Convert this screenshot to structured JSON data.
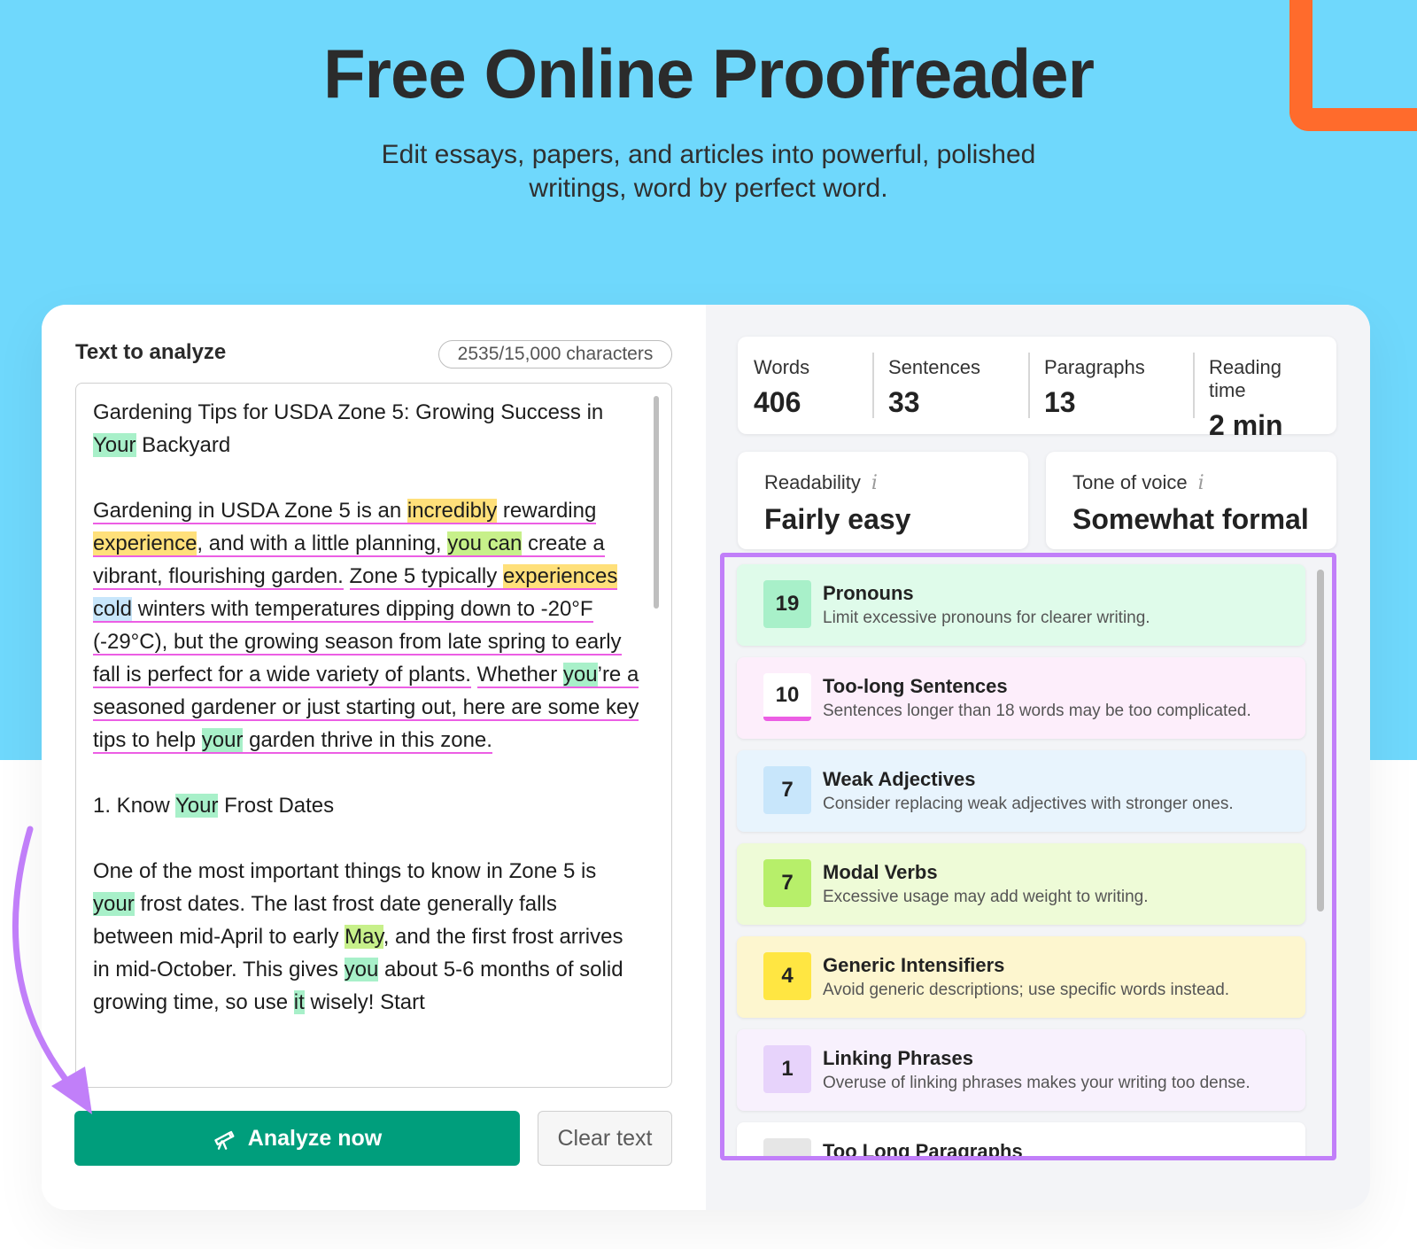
{
  "hero": {
    "title": "Free Online Proofreader",
    "subtitle_line1": "Edit essays, papers, and articles into powerful, polished",
    "subtitle_line2": "writings, word by perfect word."
  },
  "editor": {
    "label": "Text to analyze",
    "char_count": "2535/15,000 characters",
    "analyze_button": "Analyze now",
    "clear_button": "Clear text"
  },
  "text": {
    "title_a": "Gardening Tips for USDA Zone 5: Growing Success in ",
    "title_your": "Your",
    "title_b": " Backyard",
    "p1_a": "Gardening in USDA Zone 5 is an ",
    "p1_incredibly": "incredibly",
    "p1_b": " rewarding ",
    "p1_experience": "experience",
    "p1_c": ", and with a little planning, ",
    "p1_youcan": "you can",
    "p1_d": " create a vibrant, flourishing garden.",
    "p1_e": "Zone 5 typically ",
    "p1_experiences": "experiences",
    "p1_f": " ",
    "p1_cold": "cold",
    "p1_g": " winters with temperatures dipping down to -20°F (-29°C), but the growing season from late spring to early fall is perfect for a wide variety of plants.",
    "p1_h": "Whether ",
    "p1_you": "you",
    "p1_i": "’re a seasoned gardener or just starting out, here are some key tips to help ",
    "p1_your": "your",
    "p1_j": " garden thrive in this zone.",
    "h1_a": "1. Know ",
    "h1_your": "Your",
    "h1_b": " Frost Dates",
    "p2_a": "One of the most important things to know in Zone 5 is ",
    "p2_your": "your",
    "p2_b": " frost dates. The last frost date generally falls between mid-April to early ",
    "p2_may": "May",
    "p2_c": ", and the first frost arrives in mid-October. This gives ",
    "p2_you": "you",
    "p2_d": " about 5-6 months of solid growing time, so use ",
    "p2_it": "it",
    "p2_e": " wisely! Start"
  },
  "stats": [
    {
      "label": "Words",
      "value": "406"
    },
    {
      "label": "Sentences",
      "value": "33"
    },
    {
      "label": "Paragraphs",
      "value": "13"
    },
    {
      "label": "Reading time",
      "value": "2 min"
    }
  ],
  "metrics": {
    "readability_label": "Readability",
    "readability_value": "Fairly easy",
    "tone_label": "Tone of voice",
    "tone_value": "Somewhat formal",
    "info_glyph": "i"
  },
  "issues": [
    {
      "count": "19",
      "title": "Pronouns",
      "desc": "Limit excessive pronouns for clearer writing.",
      "bg": "#dffbea",
      "badge": "#a8f0c9"
    },
    {
      "count": "10",
      "title": "Too-long Sentences",
      "desc": "Sentences longer than 18 words may be too complicated.",
      "bg": "#fdeefb",
      "badge": "#ffffff"
    },
    {
      "count": "7",
      "title": "Weak Adjectives",
      "desc": "Consider replacing weak adjectives with stronger ones.",
      "bg": "#e8f4fd",
      "badge": "#c8e6fb"
    },
    {
      "count": "7",
      "title": "Modal Verbs",
      "desc": "Excessive usage may add weight to writing.",
      "bg": "#eefbd7",
      "badge": "#b7ef6a"
    },
    {
      "count": "4",
      "title": "Generic Intensifiers",
      "desc": "Avoid generic descriptions; use specific words instead.",
      "bg": "#fdf6cf",
      "badge": "#ffe642"
    },
    {
      "count": "1",
      "title": "Linking Phrases",
      "desc": "Overuse of linking phrases makes your writing too dense.",
      "bg": "#f8f1fd",
      "badge": "#e7d3fb"
    },
    {
      "count": "",
      "title": "Too Long Paragraphs",
      "desc": "",
      "bg": "#ffffff",
      "badge": "#e6e6e6"
    }
  ],
  "colors": {
    "hero_bg": "#6fd8fc",
    "accent_green": "#009e7c",
    "frame_purple": "#c17ff9",
    "underline_pink": "#ec5ee4",
    "corner_orange": "#ff6b2c"
  }
}
